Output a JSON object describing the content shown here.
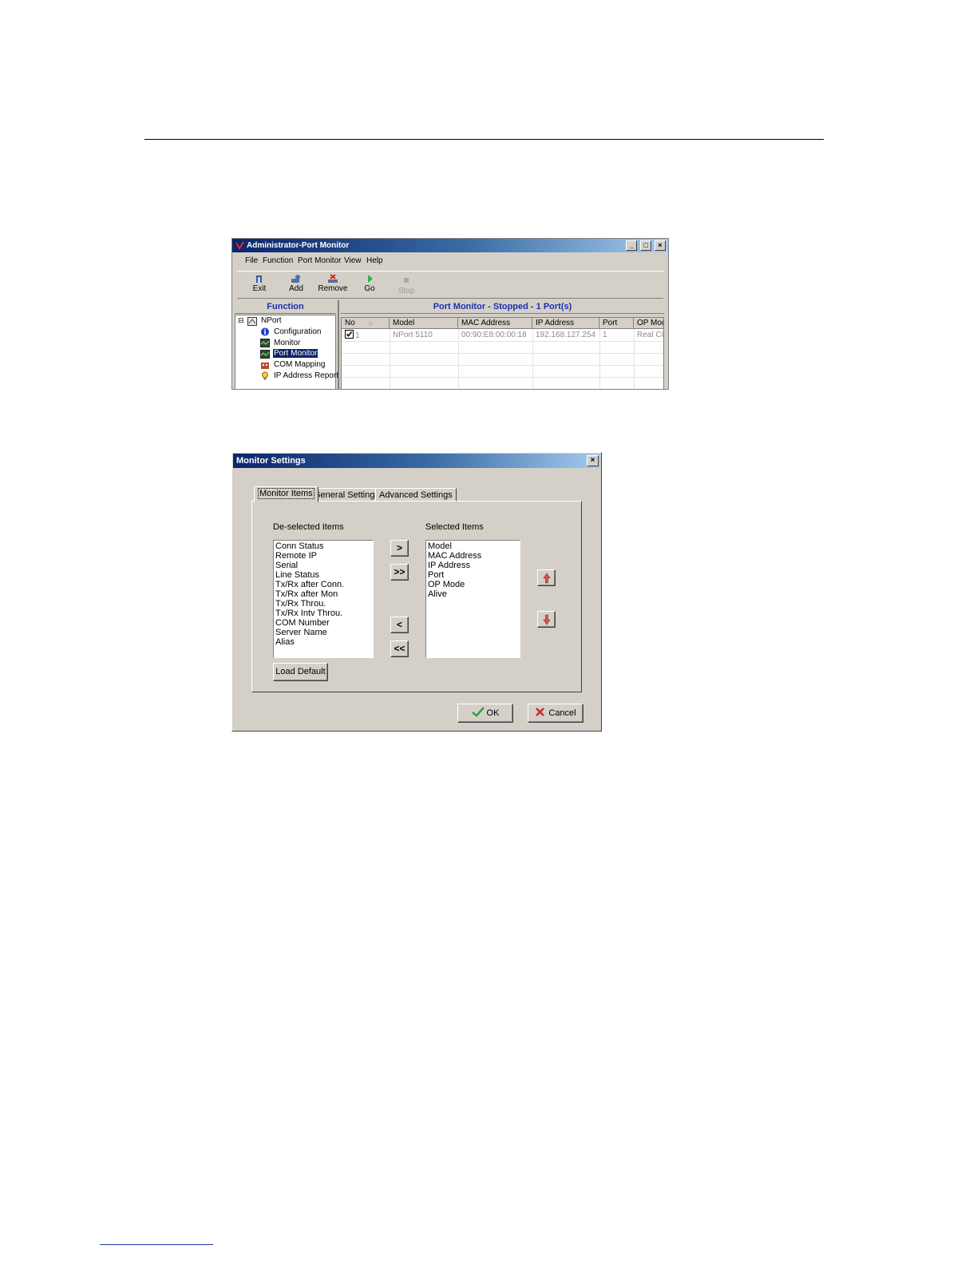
{
  "window1": {
    "title": "Administrator-Port Monitor",
    "title_buttons": [
      "_",
      "□",
      "×"
    ],
    "menu": [
      "File",
      "Function",
      "Port Monitor",
      "View",
      "Help"
    ],
    "toolbar": [
      {
        "label": "Exit",
        "icon": "exit-icon",
        "enabled": true
      },
      {
        "label": "Add",
        "icon": "add-icon",
        "enabled": true
      },
      {
        "label": "Remove",
        "icon": "remove-icon",
        "enabled": true
      },
      {
        "label": "Go",
        "icon": "go-icon",
        "enabled": true
      },
      {
        "label": "Stop",
        "icon": "stop-icon",
        "enabled": false
      }
    ],
    "function_header": "Function",
    "status_header": "Port Monitor - Stopped - 1 Port(s)",
    "tree": {
      "root": "NPort",
      "expander": "⊟",
      "items": [
        "Configuration",
        "Monitor",
        "Port Monitor",
        "COM Mapping",
        "IP Address Report"
      ],
      "selected": "Port Monitor"
    },
    "columns": [
      "No",
      "Model",
      "MAC Address",
      "IP Address",
      "Port",
      "OP Mode"
    ],
    "rows": [
      {
        "no": "1",
        "model": "NPort 5110",
        "mac": "00:90:E8:00:00:18",
        "ip": "192.168.127.254",
        "port": "1",
        "op_mode": "Real COM"
      }
    ]
  },
  "window2": {
    "title": "Monitor Settings",
    "close": "×",
    "tabs": [
      "Monitor Items",
      "General Settings",
      "Advanced Settings"
    ],
    "active_tab": "Monitor Items",
    "deselected_label": "De-selected Items",
    "selected_label": "Selected Items",
    "deselected_items": [
      "Conn Status",
      "Remote IP",
      "Serial",
      "Line Status",
      "Tx/Rx after Conn.",
      "Tx/Rx after Mon",
      "Tx/Rx Throu.",
      "Tx/Rx Intv Throu.",
      "COM Number",
      "Server Name",
      "Alias"
    ],
    "selected_items": [
      "Model",
      "MAC Address",
      "IP Address",
      "Port",
      "OP Mode",
      "Alive"
    ],
    "move_buttons": {
      "add": ">",
      "add_all": ">>",
      "remove": "<",
      "remove_all": "<<"
    },
    "load_default": "Load Default",
    "ok": "OK",
    "cancel": "Cancel"
  },
  "colors": {
    "title_dark": "#0a246a",
    "title_light": "#a6caf0",
    "panel_header": "#1b2fb5",
    "face": "#d4d0c8"
  }
}
